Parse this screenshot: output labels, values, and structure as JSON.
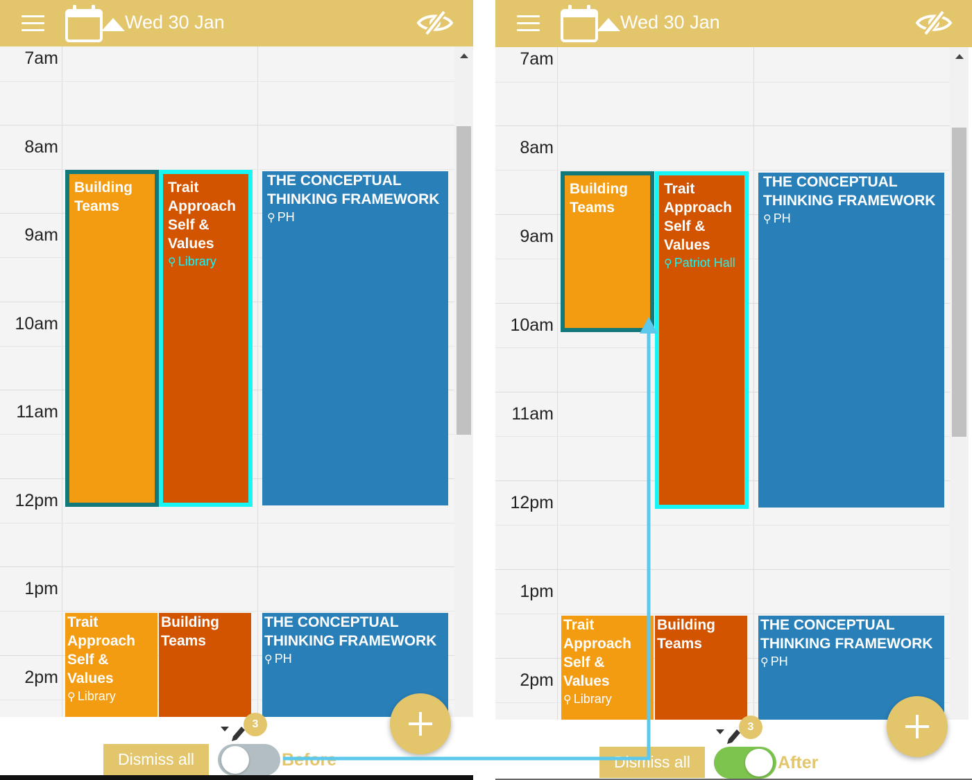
{
  "colors": {
    "header": "#e3c56c",
    "orange_event": "#f39c12",
    "red_event": "#d35400",
    "blue_event": "#2980b9",
    "teal_selection": "#12787a",
    "cyan_selection": "#18f5f5",
    "toggle_off": "#b2bec3",
    "toggle_on": "#7dc44e",
    "connector": "#5bc8ec"
  },
  "icons": {
    "menu": "hamburger-icon",
    "calendar": "calendar-icon",
    "collapse": "caret-up-icon",
    "visibility": "eye-slash-icon",
    "location": "map-pin-icon",
    "edit": "pencil-icon",
    "add": "plus-icon"
  },
  "before": {
    "header": {
      "date": "Wed 30 Jan"
    },
    "hours": [
      "7am",
      "8am",
      "9am",
      "10am",
      "11am",
      "12pm",
      "1pm",
      "2pm"
    ],
    "events": {
      "a": {
        "title_1": "Building",
        "title_2": "Teams"
      },
      "b": {
        "title_1": "Trait",
        "title_2": "Approach",
        "title_3": "Self &",
        "title_4": "Values",
        "location": "Library"
      },
      "c": {
        "title_1": "THE CONCEPTUAL",
        "title_2": "THINKING FRAMEWORK",
        "location": "PH"
      },
      "d": {
        "title_1": "Trait",
        "title_2": "Approach",
        "title_3": "Self &",
        "title_4": "Values",
        "location": "Library"
      },
      "e": {
        "title_1": "Building",
        "title_2": "Teams"
      },
      "f": {
        "title_1": "THE CONCEPTUAL",
        "title_2": "THINKING FRAMEWORK",
        "location": "PH"
      }
    },
    "footer": {
      "badge": "3",
      "dismiss": "Dismiss all",
      "toggle_label": "Before",
      "toggle_on": false
    }
  },
  "after": {
    "header": {
      "date": "Wed 30 Jan"
    },
    "hours": [
      "7am",
      "8am",
      "9am",
      "10am",
      "11am",
      "12pm",
      "1pm",
      "2pm"
    ],
    "events": {
      "a": {
        "title_1": "Building",
        "title_2": "Teams"
      },
      "b": {
        "title_1": "Trait",
        "title_2": "Approach",
        "title_3": "Self &",
        "title_4": "Values",
        "location": "Patriot Hall"
      },
      "c": {
        "title_1": "THE CONCEPTUAL",
        "title_2": "THINKING FRAMEWORK",
        "location": "PH"
      },
      "d": {
        "title_1": "Trait",
        "title_2": "Approach",
        "title_3": "Self &",
        "title_4": "Values",
        "location": "Library"
      },
      "e": {
        "title_1": "Building",
        "title_2": "Teams"
      },
      "f": {
        "title_1": "THE CONCEPTUAL",
        "title_2": "THINKING FRAMEWORK",
        "location": "PH"
      }
    },
    "footer": {
      "badge": "3",
      "dismiss": "Dismiss all",
      "toggle_label": "After",
      "toggle_on": true
    }
  }
}
